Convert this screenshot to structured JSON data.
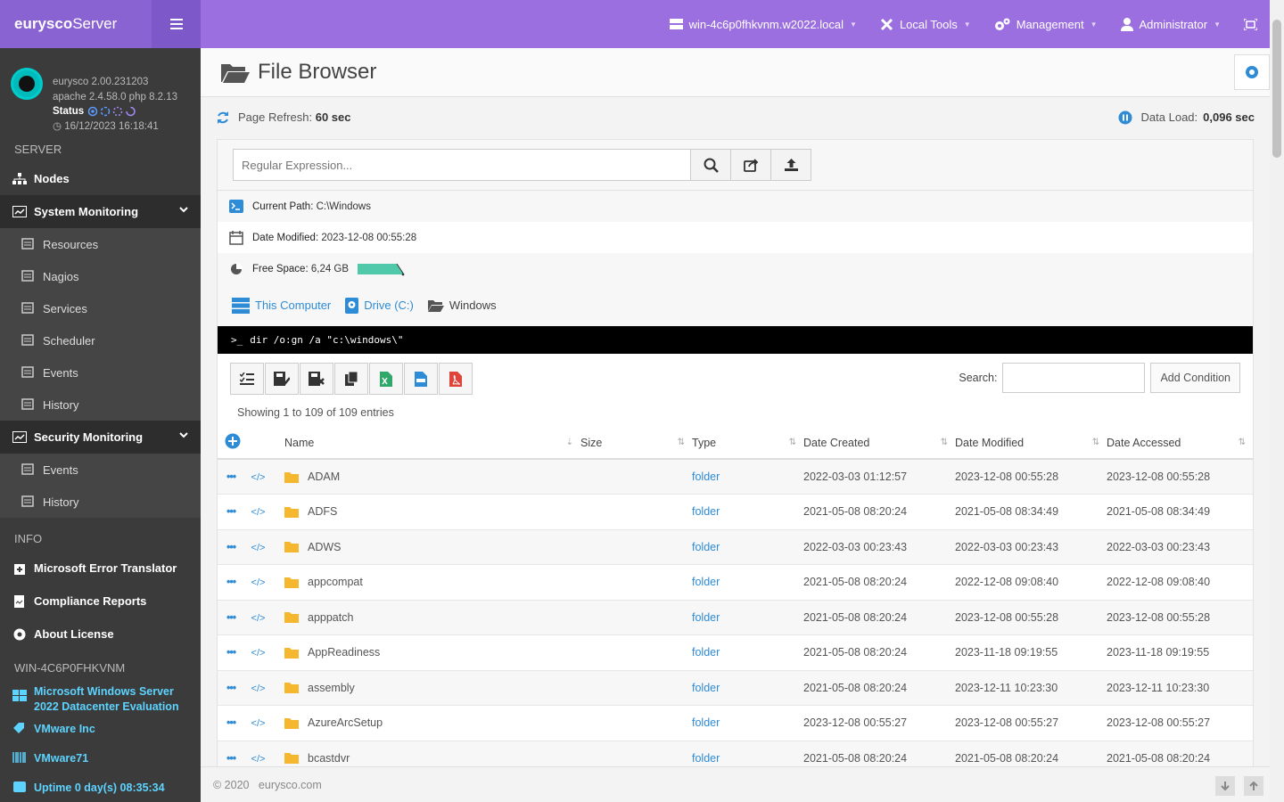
{
  "brand": {
    "logo_bold": "eurysco",
    "logo_rest": "Server"
  },
  "profile": {
    "version": "eurysco 2.00.231203",
    "stack": "apache 2.4.58.0  php 8.2.13",
    "status_label": "Status",
    "timestamp": "16/12/2023 16:18:41"
  },
  "sidebar": {
    "server_header": "SERVER",
    "nodes": "Nodes",
    "system_monitoring": "System Monitoring",
    "system_items": [
      {
        "label": "Resources",
        "icon": "resources-icon"
      },
      {
        "label": "Nagios",
        "icon": "nagios-icon"
      },
      {
        "label": "Services",
        "icon": "cog-icon"
      },
      {
        "label": "Scheduler",
        "icon": "calendar-icon"
      },
      {
        "label": "Events",
        "icon": "events-icon"
      },
      {
        "label": "History",
        "icon": "history-icon"
      }
    ],
    "security_monitoring": "Security Monitoring",
    "security_items": [
      {
        "label": "Events",
        "icon": "events-icon"
      },
      {
        "label": "History",
        "icon": "history-icon"
      }
    ],
    "info_header": "INFO",
    "info_items": [
      "Microsoft Error Translator",
      "Compliance Reports",
      "About License"
    ],
    "host_header": "WIN-4C6P0FHKVNM",
    "host_os": "Microsoft  Windows  Server 2022  Datacenter  Evaluation",
    "host_vendor": "VMware Inc",
    "host_model": "VMware71",
    "host_uptime": "Uptime 0 day(s) 08:35:34"
  },
  "topbar": {
    "host": "win-4c6p0fhkvnm.w2022.local",
    "local_tools": "Local Tools",
    "management": "Management",
    "user": "Administrator"
  },
  "page": {
    "title": "File Browser",
    "refresh_label": "Page Refresh:",
    "refresh_value": "60 sec",
    "load_label": "Data Load:",
    "load_value": "0,096 sec"
  },
  "search": {
    "placeholder": "Regular Expression..."
  },
  "info": {
    "path_label": "Current Path:",
    "path_value": "C:\\Windows",
    "modified_label": "Date Modified:",
    "modified_value": "2023-12-08 00:55:28",
    "free_label": "Free Space:",
    "free_value": "6,24 GB",
    "free_fraction": 0.9
  },
  "breadcrumb": [
    "This Computer",
    "Drive (C:)",
    "Windows"
  ],
  "command": "dir /o:gn /a \"c:\\windows\\\"",
  "table_tools": {
    "search_label": "Search:",
    "add_condition": "Add Condition",
    "showing": "Showing 1 to 109 of 109 entries"
  },
  "columns": [
    "Name",
    "Size",
    "Type",
    "Date Created",
    "Date Modified",
    "Date Accessed"
  ],
  "rows": [
    {
      "name": "ADAM",
      "size": "",
      "type": "folder",
      "created": "2022-03-03 01:12:57",
      "modified": "2023-12-08 00:55:28",
      "accessed": "2023-12-08 00:55:28"
    },
    {
      "name": "ADFS",
      "size": "",
      "type": "folder",
      "created": "2021-05-08 08:20:24",
      "modified": "2021-05-08 08:34:49",
      "accessed": "2021-05-08 08:34:49"
    },
    {
      "name": "ADWS",
      "size": "",
      "type": "folder",
      "created": "2022-03-03 00:23:43",
      "modified": "2022-03-03 00:23:43",
      "accessed": "2022-03-03 00:23:43"
    },
    {
      "name": "appcompat",
      "size": "",
      "type": "folder",
      "created": "2021-05-08 08:20:24",
      "modified": "2022-12-08 09:08:40",
      "accessed": "2022-12-08 09:08:40"
    },
    {
      "name": "apppatch",
      "size": "",
      "type": "folder",
      "created": "2021-05-08 08:20:24",
      "modified": "2023-12-08 00:55:28",
      "accessed": "2023-12-08 00:55:28"
    },
    {
      "name": "AppReadiness",
      "size": "",
      "type": "folder",
      "created": "2021-05-08 08:20:24",
      "modified": "2023-11-18 09:19:55",
      "accessed": "2023-11-18 09:19:55"
    },
    {
      "name": "assembly",
      "size": "",
      "type": "folder",
      "created": "2021-05-08 08:20:24",
      "modified": "2023-12-11 10:23:30",
      "accessed": "2023-12-11 10:23:30"
    },
    {
      "name": "AzureArcSetup",
      "size": "",
      "type": "folder",
      "created": "2023-12-08 00:55:27",
      "modified": "2023-12-08 00:55:27",
      "accessed": "2023-12-08 00:55:27"
    },
    {
      "name": "bcastdvr",
      "size": "",
      "type": "folder",
      "created": "2021-05-08 08:20:24",
      "modified": "2021-05-08 08:20:24",
      "accessed": "2021-05-08 08:20:24"
    }
  ],
  "footer": {
    "copyright": "© 2020",
    "site": "eurysco.com"
  }
}
